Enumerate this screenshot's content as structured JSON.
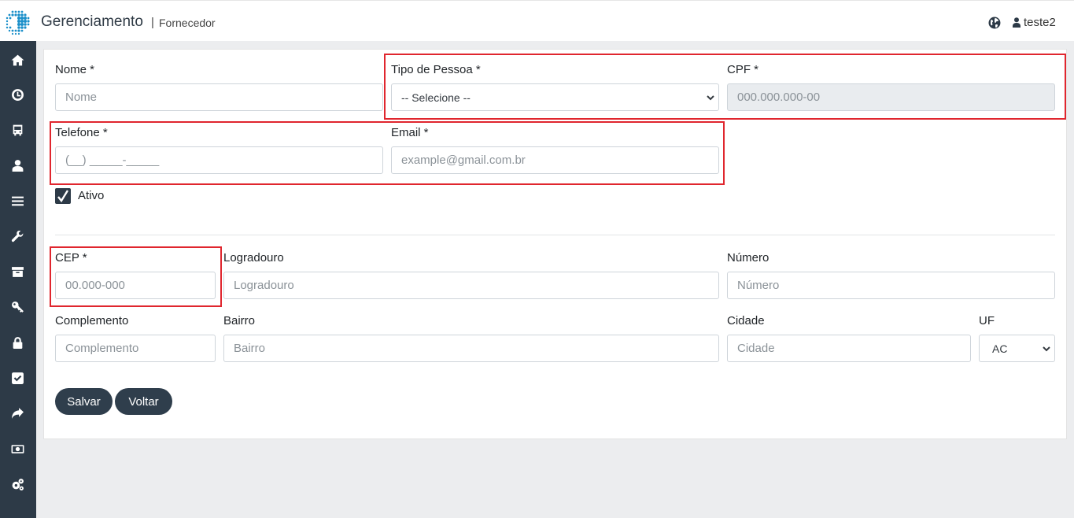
{
  "header": {
    "title": "Gerenciamento",
    "separator": "|",
    "breadcrumb": "Fornecedor",
    "user": "teste2"
  },
  "sidebar": {
    "items": [
      "home-icon",
      "clock-icon",
      "bus-icon",
      "user-icon",
      "menu-icon",
      "wrench-icon",
      "archive-icon",
      "key-icon",
      "lock-icon",
      "check-square-icon",
      "share-icon",
      "money-icon",
      "gears-icon"
    ]
  },
  "form": {
    "nome": {
      "label": "Nome *",
      "placeholder": "Nome"
    },
    "tipo_pessoa": {
      "label": "Tipo de Pessoa *",
      "value": "-- Selecione --"
    },
    "cpf": {
      "label": "CPF *",
      "placeholder": "000.000.000-00"
    },
    "telefone": {
      "label": "Telefone *",
      "placeholder": "(__) _____-_____"
    },
    "email": {
      "label": "Email *",
      "placeholder": "example@gmail.com.br"
    },
    "ativo": {
      "label": "Ativo",
      "checked": true
    },
    "cep": {
      "label": "CEP *",
      "placeholder": "00.000-000"
    },
    "logradouro": {
      "label": "Logradouro",
      "placeholder": "Logradouro"
    },
    "numero": {
      "label": "Número",
      "placeholder": "Número"
    },
    "complemento": {
      "label": "Complemento",
      "placeholder": "Complemento"
    },
    "bairro": {
      "label": "Bairro",
      "placeholder": "Bairro"
    },
    "cidade": {
      "label": "Cidade",
      "placeholder": "Cidade"
    },
    "uf": {
      "label": "UF",
      "value": "AC"
    }
  },
  "buttons": {
    "save": "Salvar",
    "back": "Voltar"
  },
  "colors": {
    "sidebar": "#2d3a47",
    "button": "#2f3e4c",
    "highlight": "#e0262e",
    "logo": "#1a8fc9"
  }
}
